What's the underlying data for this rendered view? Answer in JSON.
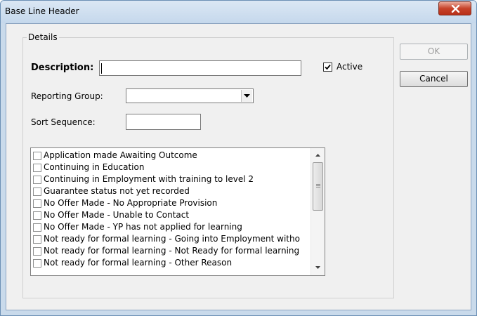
{
  "window": {
    "title": "Base Line Header"
  },
  "details": {
    "legend": "Details",
    "description_label": "Description:",
    "description_value": "",
    "active_label": "Active",
    "active_checked": true,
    "reporting_group_label": "Reporting Group:",
    "reporting_group_value": "",
    "sort_sequence_label": "Sort Sequence:",
    "sort_sequence_value": ""
  },
  "list": {
    "items": [
      {
        "label": "Application made Awaiting Outcome",
        "checked": false
      },
      {
        "label": "Continuing in Education",
        "checked": false
      },
      {
        "label": "Continuing in Employment with training to level 2",
        "checked": false
      },
      {
        "label": "Guarantee status not yet recorded",
        "checked": false
      },
      {
        "label": "No Offer Made - No Appropriate Provision",
        "checked": false
      },
      {
        "label": "No Offer Made - Unable to Contact",
        "checked": false
      },
      {
        "label": "No Offer Made - YP has not applied for learning",
        "checked": false
      },
      {
        "label": "Not ready for formal learning - Going into Employment without trai",
        "checked": false
      },
      {
        "label": "Not ready for formal learning - Not Ready for formal learning",
        "checked": false
      },
      {
        "label": "Not ready for formal learning - Other Reason",
        "checked": false
      }
    ]
  },
  "buttons": {
    "ok_label": "OK",
    "ok_enabled": false,
    "cancel_label": "Cancel"
  },
  "colors": {
    "close_button": "#c7432a",
    "title_bar": "#c5d8ec",
    "dialog_bg": "#f0f0f0"
  },
  "icons": {
    "close": "close-icon",
    "check": "check-icon",
    "dropdown": "chevron-down-icon"
  }
}
